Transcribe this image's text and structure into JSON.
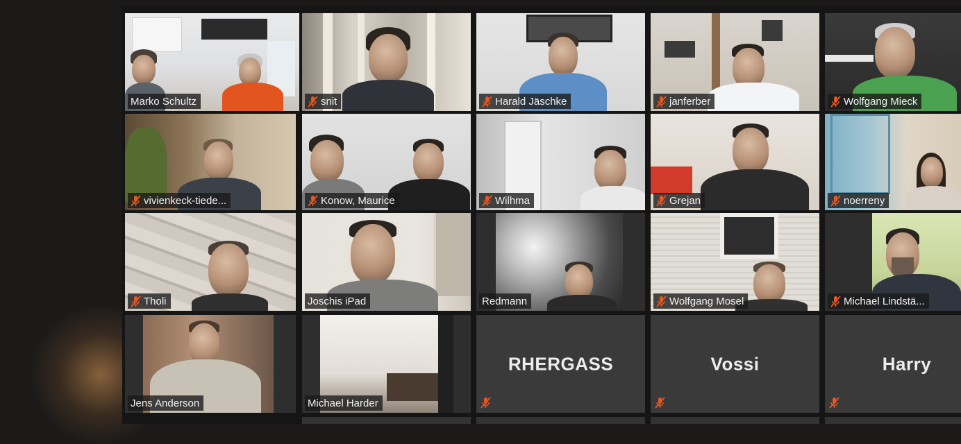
{
  "meeting": {
    "active_speaker": "Marko Schultz",
    "participants": [
      {
        "name": "Marko Schultz",
        "muted": false,
        "video": true
      },
      {
        "name": "snit",
        "muted": true,
        "video": true
      },
      {
        "name": "Harald Jäschke",
        "muted": true,
        "video": true
      },
      {
        "name": "janferber",
        "muted": true,
        "video": true
      },
      {
        "name": "Wolfgang Mieck",
        "muted": true,
        "video": true
      },
      {
        "name": "vivienkeck-tiede...",
        "muted": true,
        "video": true
      },
      {
        "name": "Konow, Maurice",
        "muted": true,
        "video": true
      },
      {
        "name": "Wilhma",
        "muted": true,
        "video": true
      },
      {
        "name": "Grejan",
        "muted": true,
        "video": true
      },
      {
        "name": "noerreny",
        "muted": true,
        "video": true
      },
      {
        "name": "Tholi",
        "muted": true,
        "video": true
      },
      {
        "name": "Joschis iPad",
        "muted": false,
        "video": true
      },
      {
        "name": "Redmann",
        "muted": false,
        "video": true
      },
      {
        "name": "Wolfgang Mosel",
        "muted": true,
        "video": true
      },
      {
        "name": "Michael Lindstä...",
        "muted": true,
        "video": true
      },
      {
        "name": "Jens Anderson",
        "muted": false,
        "video": true
      },
      {
        "name": "Michael Harder",
        "muted": false,
        "video": true
      },
      {
        "name": "RHERGASS",
        "muted": true,
        "video": false
      },
      {
        "name": "Vossi",
        "muted": true,
        "video": false
      },
      {
        "name": "Harry",
        "muted": true,
        "video": false
      }
    ]
  },
  "colors": {
    "speaker_highlight": "#e2dd41",
    "mute_icon": "#e8571f",
    "tile_off": "#3a3a3a",
    "background": "#1b1a19"
  },
  "icons": {
    "mute": "microphone-muted-icon"
  }
}
